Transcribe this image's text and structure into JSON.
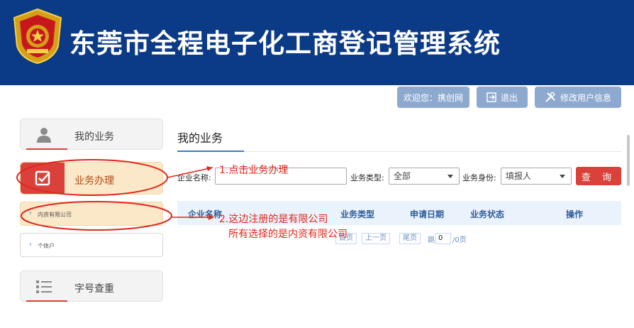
{
  "header": {
    "title": "东莞市全程电子化工商登记管理系统",
    "bg_color": "#0b3a86"
  },
  "topbar": {
    "welcome": "欢迎您：携创网",
    "logout": "退出",
    "edit_user": "修改用户信息"
  },
  "sidebar": {
    "my_business": "我的业务",
    "handle_business": "业务办理",
    "sub_limited_company": "内资有限公司",
    "sub_individual": "个体户",
    "name_check": "字号查重"
  },
  "main": {
    "tab_title": "我的业务",
    "filters": {
      "company_name_label": "企业名称:",
      "company_name_value": "",
      "business_type_label": "业务类型:",
      "business_type_value": "全部",
      "identity_label": "业务身份:",
      "identity_value": "填报人",
      "search_button": "查 询"
    },
    "table_headers": [
      "企业名称",
      "业务类型",
      "申请日期",
      "业务状态",
      "操作"
    ],
    "pagination": {
      "first": "首页",
      "prev": "上一页",
      "last": "尾页",
      "jump": "跳",
      "page_input": "0",
      "total": "/0页"
    }
  },
  "annotations": {
    "step1": "1.点击业务办理",
    "step2_line1": "2.这边注册的是有限公司",
    "step2_line2": "所有选择的是内资有限公司"
  },
  "colors": {
    "accent_red": "#d9413a",
    "annotation_red": "#e1261c",
    "active_bg": "#fbe8c8",
    "header_blue": "#0b3a86"
  }
}
